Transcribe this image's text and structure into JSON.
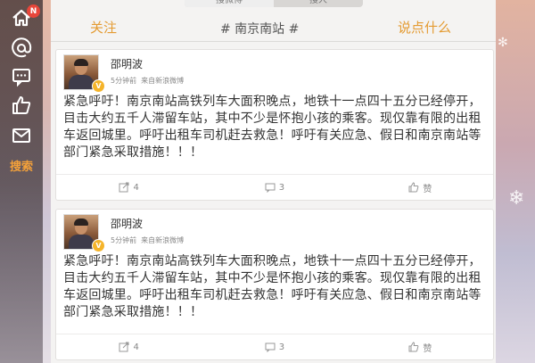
{
  "sidebar": {
    "items": [
      {
        "icon": "home-icon",
        "badge": "N"
      },
      {
        "icon": "at-icon"
      },
      {
        "icon": "comment-icon"
      },
      {
        "icon": "thumbs-up-icon"
      },
      {
        "icon": "mail-icon"
      }
    ],
    "search_label": "搜索"
  },
  "top_tabs": [
    "搜微博",
    "搜人"
  ],
  "header": {
    "left": "关注",
    "title": "# 南京南站 #",
    "right": "说点什么"
  },
  "posts": [
    {
      "username": "邵明波",
      "verified_badge": "V",
      "time": "5分钟前",
      "source": "来自新浪微博",
      "text": "紧急呼吁！南京南站高铁列车大面积晚点，地铁十一点四十五分已经停开，目击大约五千人滞留车站，其中不少是怀抱小孩的乘客。现仅靠有限的出租车返回城里。呼吁出租车司机赶去救急！呼吁有关应急、假日和南京南站等部门紧急采取措施！！！",
      "repost_count": "4",
      "comment_count": "3",
      "like_label": "赞"
    },
    {
      "username": "邵明波",
      "verified_badge": "V",
      "time": "5分钟前",
      "source": "来自新浪微博",
      "text": "紧急呼吁！南京南站高铁列车大面积晚点，地铁十一点四十五分已经停开，目击大约五千人滞留车站，其中不少是怀抱小孩的乘客。现仅靠有限的出租车返回城里。呼吁出租车司机赶去救急！呼吁有关应急、假日和南京南站等部门紧急采取措施！！！",
      "repost_count": "4",
      "comment_count": "3",
      "like_label": "赞"
    }
  ],
  "colors": {
    "accent": "#e49b32",
    "badge": "#e8463a",
    "verified": "#f5b42a"
  }
}
